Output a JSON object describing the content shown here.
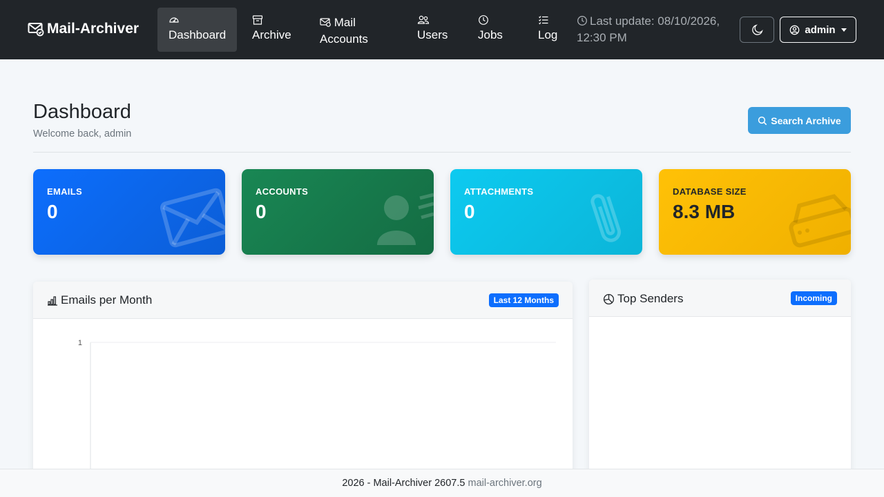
{
  "brand": {
    "name": "Mail-Archiver",
    "icon": "envelope-check-icon"
  },
  "nav": [
    {
      "label": "Dashboard",
      "icon": "speedometer-icon",
      "active": true
    },
    {
      "label": "Archive",
      "icon": "archive-box-icon"
    },
    {
      "label": "Mail",
      "label2": "Accounts",
      "icon": "mail-accounts-icon"
    },
    {
      "label": "Users",
      "icon": "users-icon"
    },
    {
      "label": "Jobs",
      "icon": "clock-icon"
    },
    {
      "label": "Log",
      "icon": "list-check-icon"
    }
  ],
  "last_update": {
    "line1": "Last update: 08/10/2026,",
    "line2": "12:30 PM",
    "icon": "clock-icon"
  },
  "user_menu": {
    "label": "admin",
    "icon": "person-circle-icon"
  },
  "theme_toggle": {
    "icon": "moon-icon"
  },
  "page": {
    "title": "Dashboard",
    "subtitle": "Welcome back, admin"
  },
  "search_button": {
    "label": "Search Archive",
    "icon": "search-icon"
  },
  "stats": [
    {
      "label": "EMAILS",
      "value": "0",
      "color": "#0d6efd",
      "icon": "envelope-icon"
    },
    {
      "label": "ACCOUNTS",
      "value": "0",
      "color": "#198754",
      "icon": "person-lines-icon"
    },
    {
      "label": "ATTACHMENTS",
      "value": "0",
      "color": "#0dcaf0",
      "icon": "paperclip-icon"
    },
    {
      "label": "DATABASE SIZE",
      "value": "8.3 MB",
      "color": "#ffc107",
      "icon": "hdd-icon"
    }
  ],
  "emails_chart": {
    "title": "Emails per Month",
    "badge": "Last 12 Months",
    "icon": "bar-chart-icon"
  },
  "chart_data": {
    "type": "bar",
    "title": "",
    "categories": [],
    "values": [],
    "ylim": [
      0,
      1
    ],
    "yticks": [
      "1"
    ],
    "grid": true
  },
  "top_senders": {
    "title": "Top Senders",
    "badge": "Incoming",
    "icon": "pie-chart-icon"
  },
  "footer": {
    "text": "2026 - Mail-Archiver 2607.5",
    "link": "mail-archiver.org"
  }
}
